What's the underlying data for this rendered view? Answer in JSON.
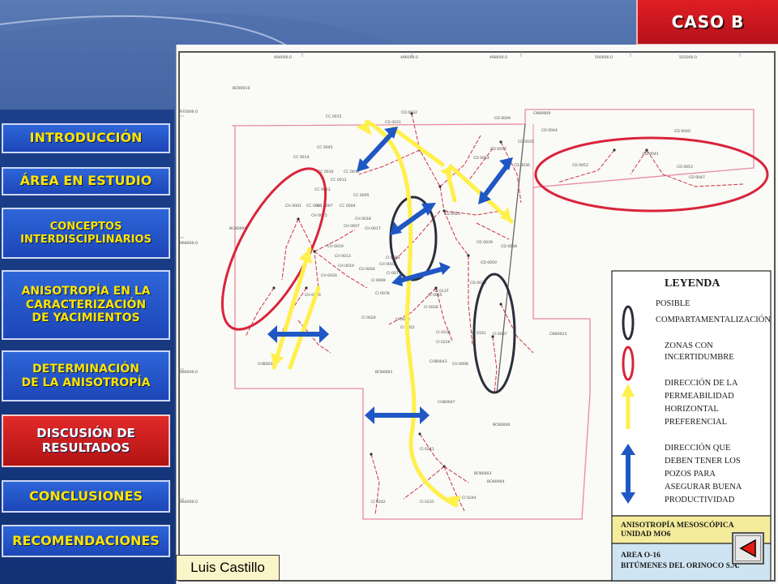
{
  "header": {
    "badge": "CASO B"
  },
  "nav": {
    "items": [
      {
        "label": "INTRODUCCIÓN"
      },
      {
        "label": "ÁREA EN ESTUDIO"
      },
      {
        "label": "CONCEPTOS\nINTERDISCIPLINARIOS"
      },
      {
        "label": "ANISOTROPÍA EN LA\nCARACTERIZACIÓN\nDE YACIMIENTOS"
      },
      {
        "label": "DETERMINACIÓN\nDE LA ANISOTROPÍA"
      },
      {
        "label": "DISCUSIÓN DE\nRESULTADOS"
      },
      {
        "label": "CONCLUSIONES"
      },
      {
        "label": "RECOMENDACIONES"
      }
    ]
  },
  "map": {
    "coords_top": [
      "494000.0",
      "496000.0",
      "498000.0",
      "500000.0",
      "502000.0"
    ],
    "coords_left": [
      "970000.0",
      "968000.0",
      "966000.0",
      "964000.0"
    ],
    "well_labels": [
      "CC 0015",
      "CD 0032",
      "CD 0031",
      "CD 0009",
      "CN00009",
      "CD 0044",
      "CD 0040",
      "CD 0035",
      "CD 0017",
      "CD 0014",
      "CD 0036",
      "CD 0052",
      "CD 0041",
      "CD 0053",
      "CD 0047",
      "CC 0045",
      "CC 0014",
      "CC 0010",
      "CC 0011",
      "CC 0012",
      "CC 0013",
      "CC 0007",
      "CC 0005",
      "CC 0004",
      "CC 0001",
      "CH 0015",
      "CH 0018",
      "CH 0007",
      "CH 0017",
      "CH 0019",
      "CH 0013",
      "CH 0010",
      "CH 0003",
      "CH 0004",
      "CH 0020",
      "CI 0069",
      "CI 0081",
      "CI 0077",
      "CI 0078",
      "CI 0030",
      "CI 0052",
      "CI 0029",
      "CI 0028",
      "CI 0055",
      "CI 0137",
      "CI 0238",
      "CI 0216",
      "CI 0191",
      "CI 0007",
      "CD 0038",
      "CD 0025",
      "CD 0039",
      "CD 0050",
      "CD 0028",
      "CI 0231",
      "CI 0241",
      "CI 0242",
      "CI 0244",
      "BCN0004",
      "CN00024",
      "BCN0006",
      "BCN0003",
      "CHB0043",
      "CH 0008",
      "BCN0001",
      "BCN0008",
      "BCN0010",
      "CH 0001",
      "CHB0038",
      "CH 0009",
      "CHB0047"
    ]
  },
  "legend": {
    "title": "LEYENDA",
    "items": [
      {
        "label": "POSIBLE\nCOMPARTAMENTALIZACIÓN"
      },
      {
        "label": "ZONAS CON\nINCERTIDUMBRE"
      },
      {
        "label": "DIRECCIÓN DE LA\nPERMEABILIDAD\nHORIZONTAL\nPREFERENCIAL"
      },
      {
        "label": "DIRECCIÓN QUE\nDEBEN TENER LOS\nPOZOS PARA\nASEGURAR BUENA\nPRODUCTIVIDAD"
      }
    ],
    "footer1": "ANISOTROPÍA MESOSCÓPICA\nUNIDAD MO6",
    "footer2": "AREA O-16\nBITÚMENES DEL ORINOCO S.A."
  },
  "author": "Luis Castillo",
  "colors": {
    "accent_red": "#e01e24",
    "nav_blue": "#2e66d8",
    "nav_text": "#ffe400",
    "arrow_yellow": "#fff04a",
    "arrow_blue": "#1f57c4",
    "ellipse_red": "#d9243a",
    "ellipse_dark": "#2a2f3a",
    "legend_yellow": "#f4ec9a",
    "legend_blue": "#cfe4f2"
  },
  "icons": {
    "back": "back-triangle-icon"
  }
}
